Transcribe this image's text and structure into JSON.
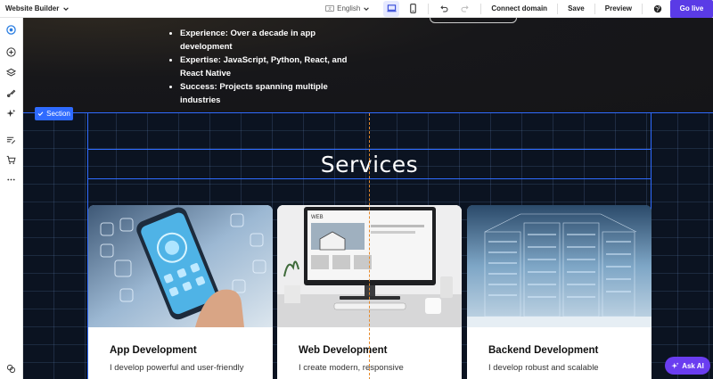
{
  "topbar": {
    "brand": "Website Builder",
    "language": "English",
    "connect_domain": "Connect domain",
    "save": "Save",
    "preview": "Preview",
    "go_live": "Go live"
  },
  "about": {
    "bullets": [
      "Experience: Over a decade in app development",
      "Expertise: JavaScript, Python, React, and React Native",
      "Success: Projects spanning multiple industries"
    ]
  },
  "services": {
    "badge": "Section",
    "title": "Services",
    "cards": [
      {
        "title": "App Development",
        "text": "I develop powerful and user-friendly"
      },
      {
        "title": "Web Development",
        "text": "I create modern, responsive"
      },
      {
        "title": "Backend Development",
        "text": "I develop robust and scalable"
      }
    ]
  },
  "ask_ai": "Ask AI",
  "colors": {
    "accent": "#5a3be6",
    "selection": "#2f6bff",
    "guide": "#e58a2c"
  }
}
